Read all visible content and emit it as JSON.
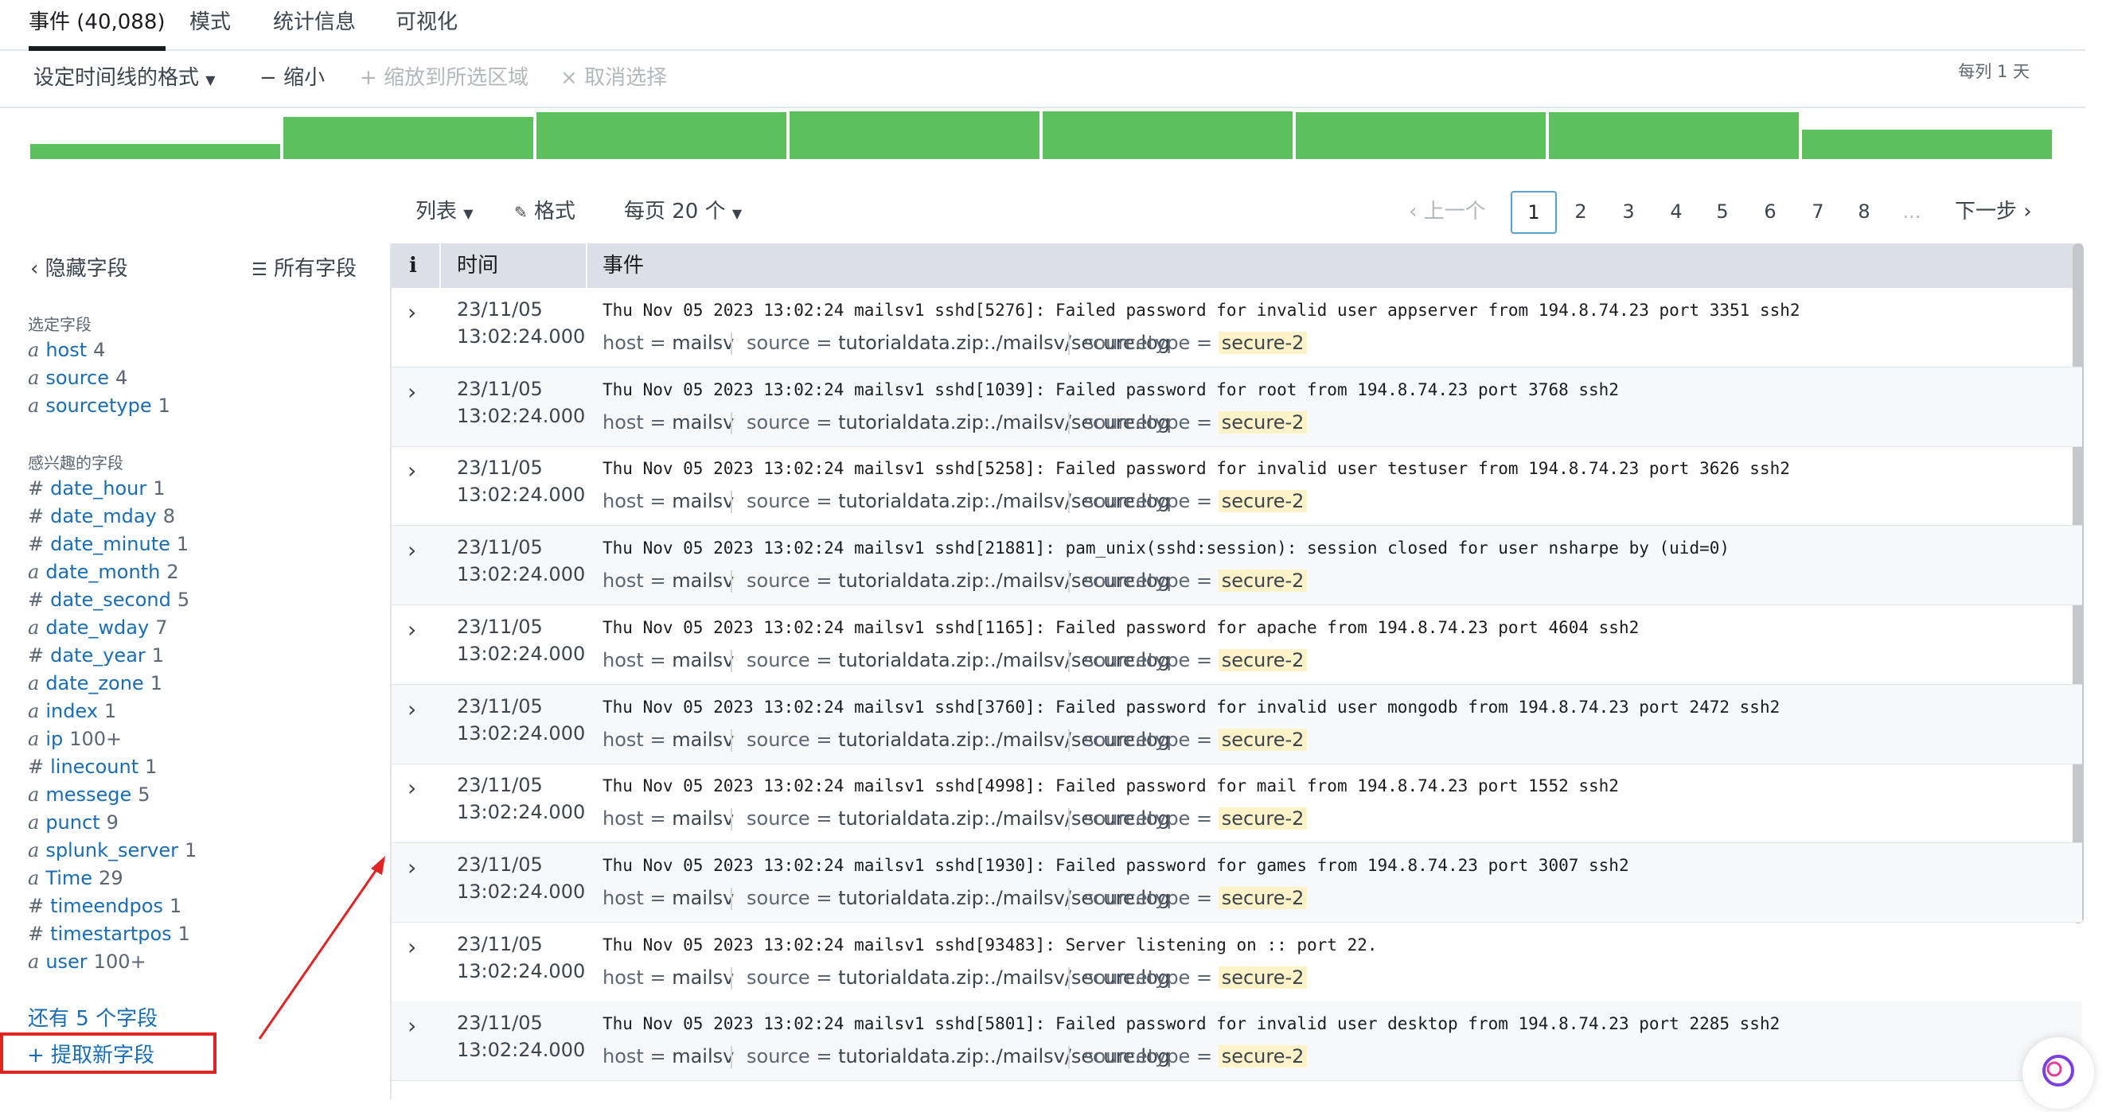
{
  "tabs": [
    {
      "label": "事件 (40,088)",
      "active": true
    },
    {
      "label": "模式"
    },
    {
      "label": "统计信息"
    },
    {
      "label": "可视化"
    }
  ],
  "timeline_toolbar": {
    "format": "设定时间线的格式",
    "zoom_out": "缩小",
    "zoom_to_selection": "缩放到所选区域",
    "deselect": "取消选择",
    "per_column": "每列 1 天"
  },
  "timeline": {
    "bar_color": "#5cc05c",
    "bars": [
      0.3,
      0.85,
      0.95,
      0.97,
      0.97,
      0.95,
      0.95,
      0.6
    ]
  },
  "list_toolbar": {
    "list": "列表",
    "format": "格式",
    "per_page": "每页 20 个",
    "prev": "上一个",
    "next": "下一步",
    "pages": [
      "1",
      "2",
      "3",
      "4",
      "5",
      "6",
      "7",
      "8",
      "..."
    ],
    "current_page": "1"
  },
  "sidebar": {
    "hide_fields": "隐藏字段",
    "all_fields": "所有字段",
    "selected_title": "选定字段",
    "selected": [
      {
        "type": "a",
        "name": "host",
        "count": "4"
      },
      {
        "type": "a",
        "name": "source",
        "count": "4"
      },
      {
        "type": "a",
        "name": "sourcetype",
        "count": "1"
      }
    ],
    "interesting_title": "感兴趣的字段",
    "interesting": [
      {
        "type": "#",
        "name": "date_hour",
        "count": "1"
      },
      {
        "type": "#",
        "name": "date_mday",
        "count": "8"
      },
      {
        "type": "#",
        "name": "date_minute",
        "count": "1"
      },
      {
        "type": "a",
        "name": "date_month",
        "count": "2"
      },
      {
        "type": "#",
        "name": "date_second",
        "count": "5"
      },
      {
        "type": "a",
        "name": "date_wday",
        "count": "7"
      },
      {
        "type": "#",
        "name": "date_year",
        "count": "1"
      },
      {
        "type": "a",
        "name": "date_zone",
        "count": "1"
      },
      {
        "type": "a",
        "name": "index",
        "count": "1"
      },
      {
        "type": "a",
        "name": "ip",
        "count": "100+"
      },
      {
        "type": "#",
        "name": "linecount",
        "count": "1"
      },
      {
        "type": "a",
        "name": "messege",
        "count": "5"
      },
      {
        "type": "a",
        "name": "punct",
        "count": "9"
      },
      {
        "type": "a",
        "name": "splunk_server",
        "count": "1"
      },
      {
        "type": "a",
        "name": "Time",
        "count": "29"
      },
      {
        "type": "#",
        "name": "timeendpos",
        "count": "1"
      },
      {
        "type": "#",
        "name": "timestartpos",
        "count": "1"
      },
      {
        "type": "a",
        "name": "user",
        "count": "100+"
      }
    ],
    "more_fields": "还有 5 个字段",
    "extract_new": "+ 提取新字段"
  },
  "table": {
    "col_info": "i",
    "col_time": "时间",
    "col_event": "事件",
    "kv_keys": {
      "host": "host =",
      "source": "source =",
      "sourcetype": "sourcetype ="
    },
    "rows": [
      {
        "date": "23/11/05",
        "time": "13:02:24.000",
        "event": "Thu Nov 05 2023 13:02:24 mailsv1 sshd[5276]: Failed password for invalid user appserver from 194.8.74.23 port 3351 ssh2",
        "host": "mailsv",
        "source": "tutorialdata.zip:./mailsv/secure.log",
        "sourcetype": "secure-2"
      },
      {
        "date": "23/11/05",
        "time": "13:02:24.000",
        "event": "Thu Nov 05 2023 13:02:24 mailsv1 sshd[1039]: Failed password for root from 194.8.74.23 port 3768 ssh2",
        "host": "mailsv",
        "source": "tutorialdata.zip:./mailsv/secure.log",
        "sourcetype": "secure-2"
      },
      {
        "date": "23/11/05",
        "time": "13:02:24.000",
        "event": "Thu Nov 05 2023 13:02:24 mailsv1 sshd[5258]: Failed password for invalid user testuser from 194.8.74.23 port 3626 ssh2",
        "host": "mailsv",
        "source": "tutorialdata.zip:./mailsv/secure.log",
        "sourcetype": "secure-2"
      },
      {
        "date": "23/11/05",
        "time": "13:02:24.000",
        "event": "Thu Nov 05 2023 13:02:24 mailsv1 sshd[21881]: pam_unix(sshd:session): session closed for user nsharpe by (uid=0)",
        "host": "mailsv",
        "source": "tutorialdata.zip:./mailsv/secure.log",
        "sourcetype": "secure-2"
      },
      {
        "date": "23/11/05",
        "time": "13:02:24.000",
        "event": "Thu Nov 05 2023 13:02:24 mailsv1 sshd[1165]: Failed password for apache from 194.8.74.23 port 4604 ssh2",
        "host": "mailsv",
        "source": "tutorialdata.zip:./mailsv/secure.log",
        "sourcetype": "secure-2"
      },
      {
        "date": "23/11/05",
        "time": "13:02:24.000",
        "event": "Thu Nov 05 2023 13:02:24 mailsv1 sshd[3760]: Failed password for invalid user mongodb from 194.8.74.23 port 2472 ssh2",
        "host": "mailsv",
        "source": "tutorialdata.zip:./mailsv/secure.log",
        "sourcetype": "secure-2"
      },
      {
        "date": "23/11/05",
        "time": "13:02:24.000",
        "event": "Thu Nov 05 2023 13:02:24 mailsv1 sshd[4998]: Failed password for mail from 194.8.74.23 port 1552 ssh2",
        "host": "mailsv",
        "source": "tutorialdata.zip:./mailsv/secure.log",
        "sourcetype": "secure-2"
      },
      {
        "date": "23/11/05",
        "time": "13:02:24.000",
        "event": "Thu Nov 05 2023 13:02:24 mailsv1 sshd[1930]: Failed password for games from 194.8.74.23 port 3007 ssh2",
        "host": "mailsv",
        "source": "tutorialdata.zip:./mailsv/secure.log",
        "sourcetype": "secure-2"
      },
      {
        "date": "23/11/05",
        "time": "13:02:24.000",
        "event": "Thu Nov 05 2023 13:02:24 mailsv1 sshd[93483]: Server listening on :: port 22.",
        "host": "mailsv",
        "source": "tutorialdata.zip:./mailsv/secure.log",
        "sourcetype": "secure-2"
      },
      {
        "date": "23/11/05",
        "time": "13:02:24.000",
        "event": "Thu Nov 05 2023 13:02:24 mailsv1 sshd[5801]: Failed password for invalid user desktop from 194.8.74.23 port 2285 ssh2",
        "host": "mailsv",
        "source": "tutorialdata.zip:./mailsv/secure.log",
        "sourcetype": "secure-2"
      }
    ]
  },
  "colors": {
    "link": "#1a6cb5",
    "highlight": "#fdf2c8",
    "annotation_red": "#e02424"
  }
}
